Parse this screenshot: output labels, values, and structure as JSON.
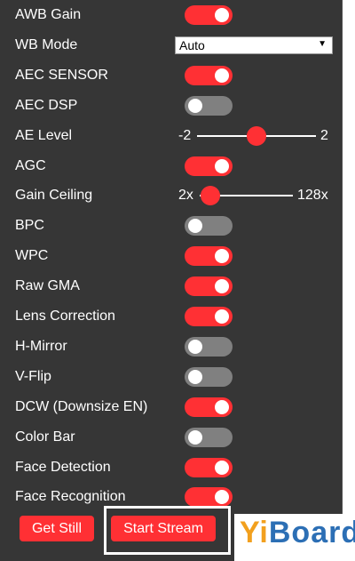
{
  "settings": [
    {
      "id": "awb-gain",
      "type": "toggle",
      "label": "AWB Gain",
      "on": true
    },
    {
      "id": "wb-mode",
      "type": "select",
      "label": "WB Mode",
      "value": "Auto"
    },
    {
      "id": "aec-sensor",
      "type": "toggle",
      "label": "AEC SENSOR",
      "on": true
    },
    {
      "id": "aec-dsp",
      "type": "toggle",
      "label": "AEC DSP",
      "on": false
    },
    {
      "id": "ae-level",
      "type": "slider",
      "label": "AE Level",
      "min_label": "-2",
      "max_label": "2",
      "value": 0,
      "min": -2,
      "max": 2
    },
    {
      "id": "agc",
      "type": "toggle",
      "label": "AGC",
      "on": true
    },
    {
      "id": "gain-ceiling",
      "type": "slider",
      "label": "Gain Ceiling",
      "min_label": "2x",
      "max_label": "128x",
      "value": 0,
      "min": 0,
      "max": 6
    },
    {
      "id": "bpc",
      "type": "toggle",
      "label": "BPC",
      "on": false
    },
    {
      "id": "wpc",
      "type": "toggle",
      "label": "WPC",
      "on": true
    },
    {
      "id": "raw-gma",
      "type": "toggle",
      "label": "Raw GMA",
      "on": true
    },
    {
      "id": "lens-correction",
      "type": "toggle",
      "label": "Lens Correction",
      "on": true
    },
    {
      "id": "h-mirror",
      "type": "toggle",
      "label": "H-Mirror",
      "on": false
    },
    {
      "id": "v-flip",
      "type": "toggle",
      "label": "V-Flip",
      "on": false
    },
    {
      "id": "dcw",
      "type": "toggle",
      "label": "DCW (Downsize EN)",
      "on": true
    },
    {
      "id": "color-bar",
      "type": "toggle",
      "label": "Color Bar",
      "on": false
    },
    {
      "id": "face-detection",
      "type": "toggle",
      "label": "Face Detection",
      "on": true
    },
    {
      "id": "face-recognition",
      "type": "toggle",
      "label": "Face Recognition",
      "on": true
    }
  ],
  "buttons": {
    "get_still": "Get Still",
    "start_stream": "Start Stream"
  },
  "watermark": {
    "text_y": "Yi",
    "text_rest": "Board"
  },
  "colors": {
    "accent": "#ff3034",
    "panel": "#363636",
    "toggle_off": "#808080"
  }
}
